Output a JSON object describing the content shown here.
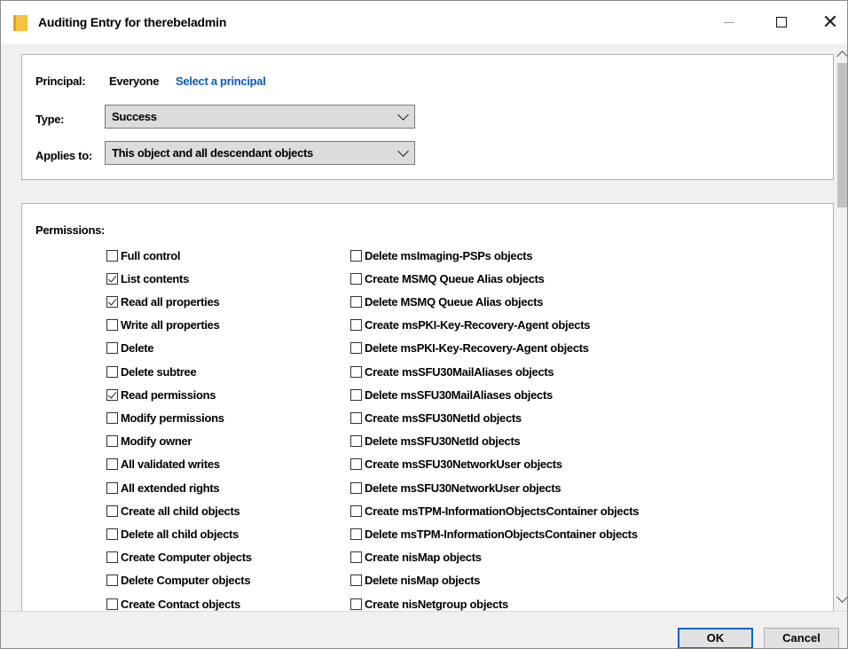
{
  "window": {
    "title": "Auditing Entry for therebeladmin"
  },
  "principal": {
    "label": "Principal:",
    "value": "Everyone",
    "link": "Select a principal"
  },
  "type": {
    "label": "Type:",
    "selected": "Success"
  },
  "applies_to": {
    "label": "Applies to:",
    "selected": "This object and all descendant objects"
  },
  "permissions": {
    "heading": "Permissions:",
    "column1": [
      {
        "label": "Full control",
        "checked": false
      },
      {
        "label": "List contents",
        "checked": true
      },
      {
        "label": "Read all properties",
        "checked": true
      },
      {
        "label": "Write all properties",
        "checked": false
      },
      {
        "label": "Delete",
        "checked": false
      },
      {
        "label": "Delete subtree",
        "checked": false
      },
      {
        "label": "Read permissions",
        "checked": true
      },
      {
        "label": "Modify permissions",
        "checked": false
      },
      {
        "label": "Modify owner",
        "checked": false
      },
      {
        "label": "All validated writes",
        "checked": false
      },
      {
        "label": "All extended rights",
        "checked": false
      },
      {
        "label": "Create all child objects",
        "checked": false
      },
      {
        "label": "Delete all child objects",
        "checked": false
      },
      {
        "label": "Create Computer objects",
        "checked": false
      },
      {
        "label": "Delete Computer objects",
        "checked": false
      },
      {
        "label": "Create Contact objects",
        "checked": false
      }
    ],
    "column2": [
      {
        "label": "Delete msImaging-PSPs objects",
        "checked": false
      },
      {
        "label": "Create MSMQ Queue Alias objects",
        "checked": false
      },
      {
        "label": "Delete MSMQ Queue Alias objects",
        "checked": false
      },
      {
        "label": "Create msPKI-Key-Recovery-Agent objects",
        "checked": false
      },
      {
        "label": "Delete msPKI-Key-Recovery-Agent objects",
        "checked": false
      },
      {
        "label": "Create msSFU30MailAliases objects",
        "checked": false
      },
      {
        "label": "Delete msSFU30MailAliases objects",
        "checked": false
      },
      {
        "label": "Create msSFU30NetId objects",
        "checked": false
      },
      {
        "label": "Delete msSFU30NetId objects",
        "checked": false
      },
      {
        "label": "Create msSFU30NetworkUser objects",
        "checked": false
      },
      {
        "label": "Delete msSFU30NetworkUser objects",
        "checked": false
      },
      {
        "label": "Create msTPM-InformationObjectsContainer objects",
        "checked": false
      },
      {
        "label": "Delete msTPM-InformationObjectsContainer objects",
        "checked": false
      },
      {
        "label": "Create nisMap objects",
        "checked": false
      },
      {
        "label": "Delete nisMap objects",
        "checked": false
      },
      {
        "label": "Create nisNetgroup objects",
        "checked": false
      }
    ]
  },
  "footer": {
    "ok_label": "OK",
    "cancel_label": "Cancel"
  },
  "icons": {
    "window_icon": "folder-icon",
    "close": "close-icon",
    "minimize": "minimize-icon",
    "maximize": "maximize-icon"
  }
}
